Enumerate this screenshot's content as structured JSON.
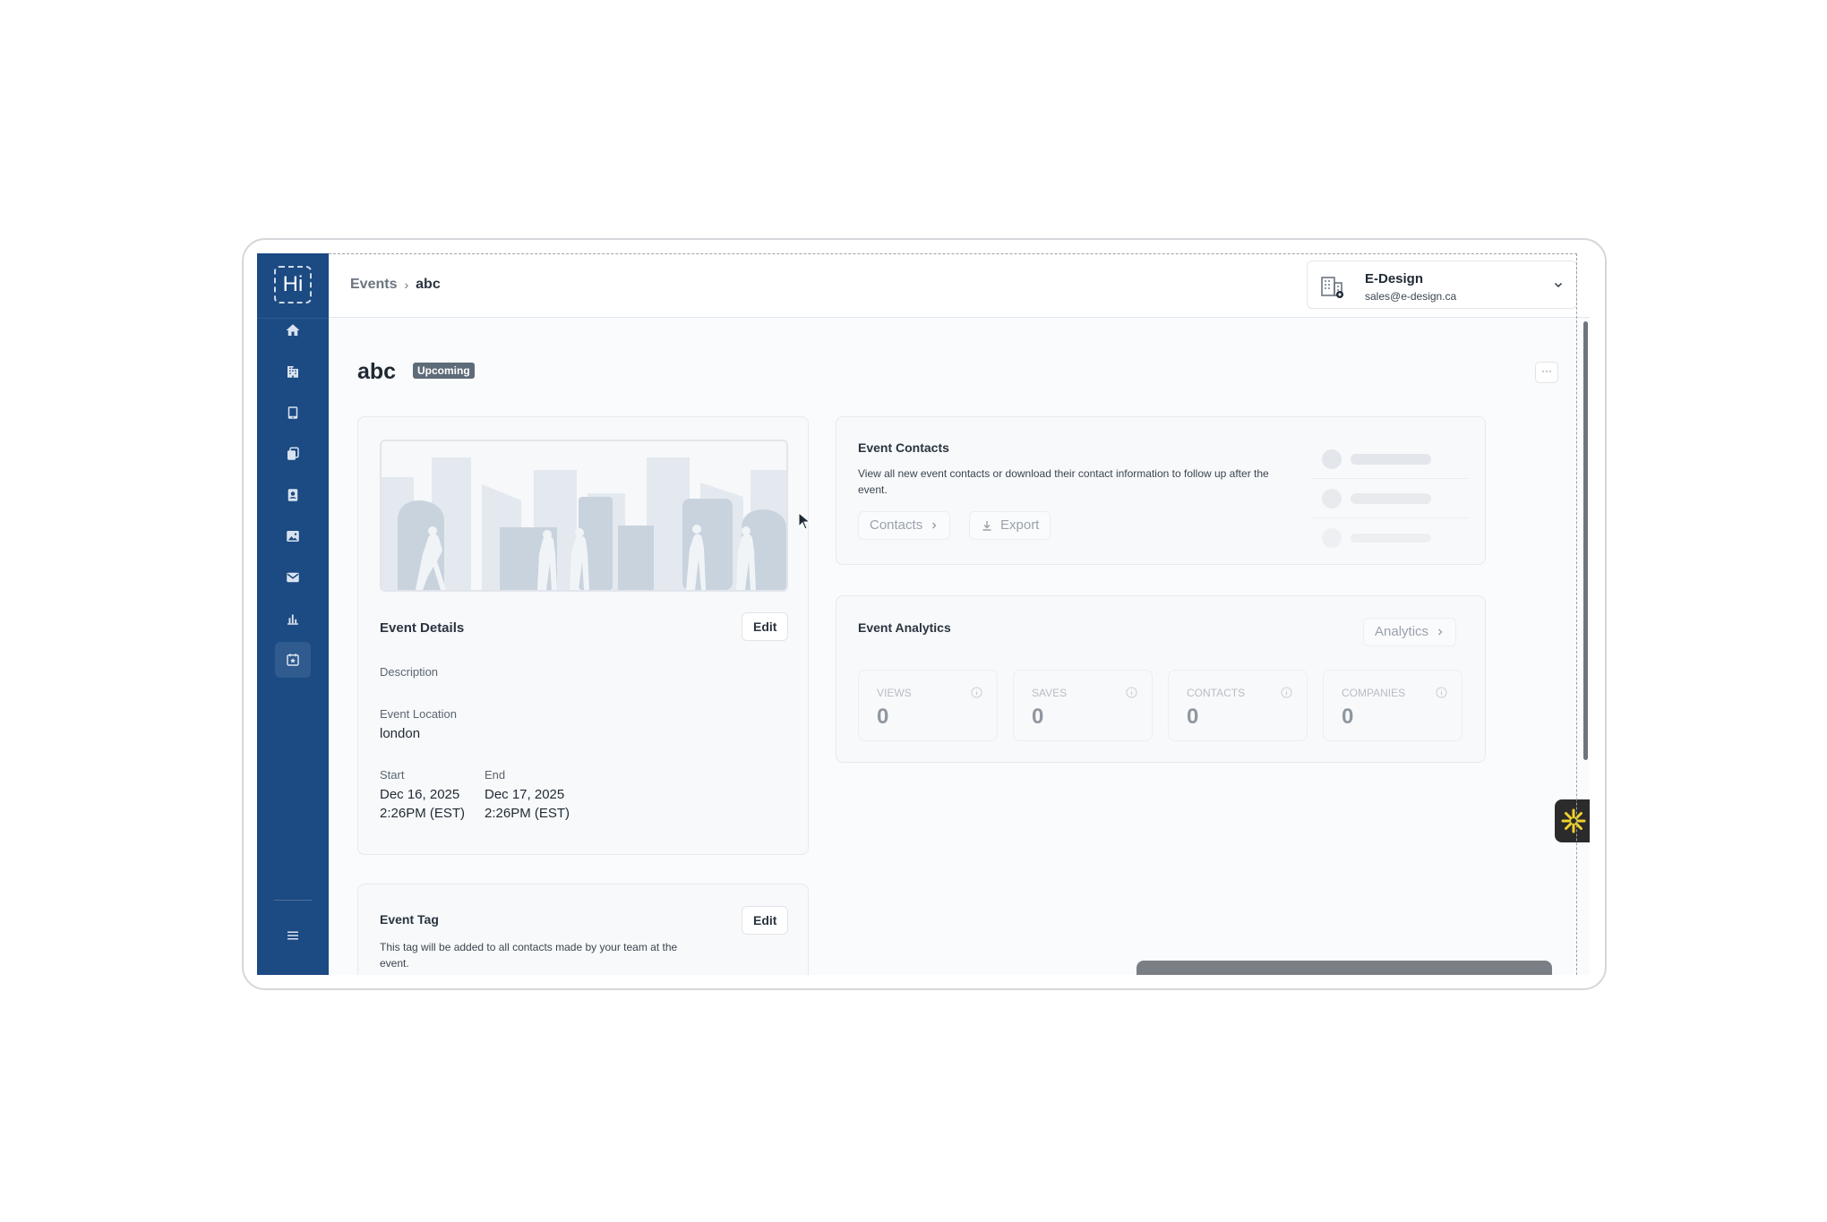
{
  "app": {
    "logo_text": "Hi"
  },
  "sidebar": {
    "items": [
      {
        "name": "home-icon"
      },
      {
        "name": "building-icon"
      },
      {
        "name": "tablet-icon"
      },
      {
        "name": "copy-icon"
      },
      {
        "name": "contact-card-icon"
      },
      {
        "name": "image-icon"
      },
      {
        "name": "mail-icon"
      },
      {
        "name": "chart-icon"
      },
      {
        "name": "calendar-star-icon",
        "active": true
      }
    ],
    "menu_icon": "menu-icon"
  },
  "breadcrumb": {
    "root": "Events",
    "separator": "›",
    "current": "abc"
  },
  "account": {
    "name": "E-Design",
    "email": "sales@e-design.ca"
  },
  "page": {
    "title": "abc",
    "status": "Upcoming",
    "more": "···"
  },
  "event_details": {
    "title": "Event Details",
    "edit_label": "Edit",
    "description_label": "Description",
    "location_label": "Event Location",
    "location_value": "london",
    "start_label": "Start",
    "start_date": "Dec 16, 2025",
    "start_time": "2:26PM (EST)",
    "end_label": "End",
    "end_date": "Dec 17, 2025",
    "end_time": "2:26PM (EST)"
  },
  "event_contacts": {
    "title": "Event Contacts",
    "description": "View all new event contacts or download their contact information to follow up after the event.",
    "contacts_label": "Contacts",
    "export_label": "Export"
  },
  "event_analytics": {
    "title": "Event Analytics",
    "analytics_label": "Analytics",
    "stats": [
      {
        "label": "VIEWS",
        "value": "0"
      },
      {
        "label": "SAVES",
        "value": "0"
      },
      {
        "label": "CONTACTS",
        "value": "0"
      },
      {
        "label": "COMPANIES",
        "value": "0"
      }
    ]
  },
  "event_tag": {
    "title": "Event Tag",
    "edit_label": "Edit",
    "description": "This tag will be added to all contacts made by your team at the event."
  },
  "colors": {
    "sidebar": "#1c4a83",
    "badge": "#5e6b78",
    "plugin_accent": "#f0d22a"
  }
}
